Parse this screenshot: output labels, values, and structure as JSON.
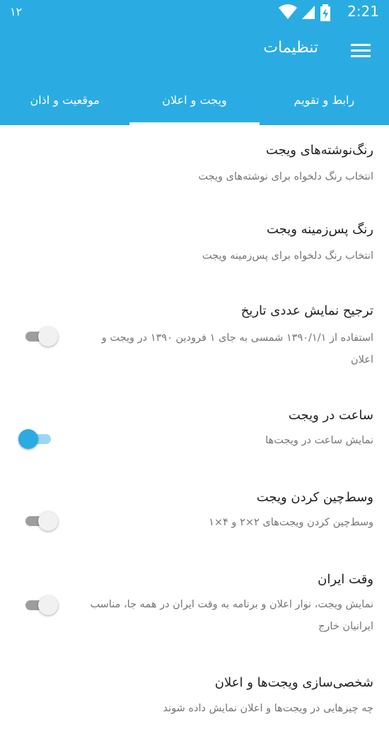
{
  "status_bar": {
    "notification_count": "۱۲",
    "time": "2:21"
  },
  "app_bar": {
    "title": "تنظیمات",
    "menu_icon": "hamburger-menu-icon"
  },
  "tabs": [
    {
      "label": "رابط و تقویم",
      "active": false
    },
    {
      "label": "ویجت و اعلان",
      "active": true
    },
    {
      "label": "موقعیت و اذان",
      "active": false
    }
  ],
  "settings": [
    {
      "title": "رنگ‌نوشته‌های ویجت",
      "subtitle": "انتخاب رنگ دلخواه برای نوشته‌های ویجت"
    },
    {
      "title": "رنگ پس‌زمینه ویجت",
      "subtitle": "انتخاب رنگ دلخواه برای پس‌زمینه ویجت"
    },
    {
      "title": "ترجیح نمایش عددی تاریخ",
      "subtitle": "استفاده از ۱۳۹۰/۱/۱ شمسی به جای ۱ فرودین ۱۳۹۰ در ویجت و اعلان",
      "toggle": "off"
    },
    {
      "title": "ساعت در ویجت",
      "subtitle": "نمایش ساعت در ویجت‌ها",
      "toggle": "on"
    },
    {
      "title": "وسط‌چین کردن ویجت",
      "subtitle": "وسط‌چین کردن ویجت‌های ۲×۲ و ۴×۱",
      "toggle": "off"
    },
    {
      "title": "وقت ایران",
      "subtitle": "نمایش ویجت، نوار اعلان و برنامه به وقت ایران در همه جا، مناسب ایرانیان خارج",
      "toggle": "off"
    },
    {
      "title": "شخصی‌سازی ویجت‌ها و اعلان",
      "subtitle": "چه چیزهایی در ویجت‌ها و اعلان نمایش داده شوند"
    }
  ],
  "colors": {
    "primary": "#2aace2",
    "title_text": "#212121",
    "subtitle_text": "#757575"
  }
}
